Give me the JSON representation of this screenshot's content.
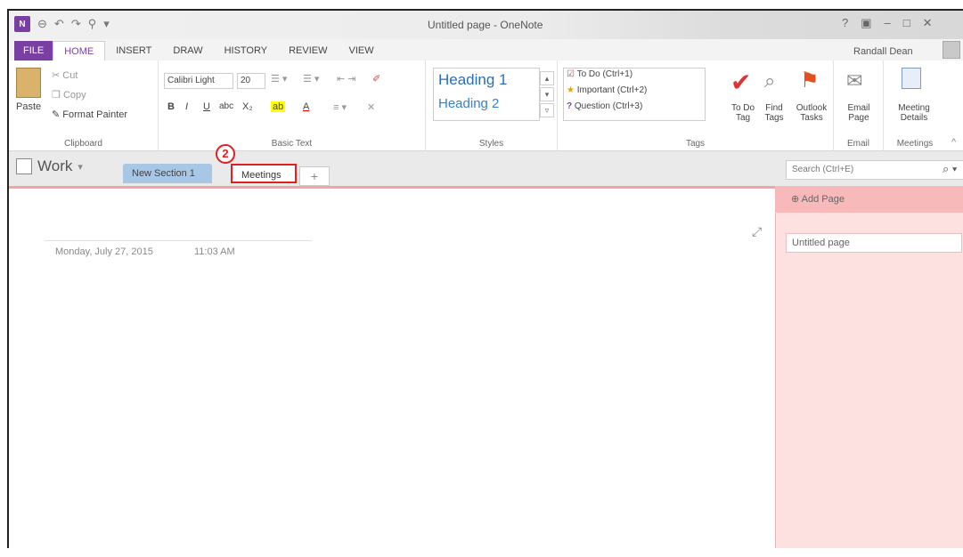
{
  "title_bar": {
    "app_title": "Untitled page - OneNote",
    "logo_text": "N",
    "user_name": "Randall Dean",
    "window_controls": [
      "?",
      "▣",
      "–",
      "□",
      "✕"
    ]
  },
  "ribbon_tabs": [
    "FILE",
    "HOME",
    "INSERT",
    "DRAW",
    "HISTORY",
    "REVIEW",
    "VIEW"
  ],
  "clipboard": {
    "paste": "Paste",
    "cut": "Cut",
    "copy": "Copy",
    "format_painter": "Format Painter",
    "label": "Clipboard"
  },
  "basic_text": {
    "font_name": "Calibri Light",
    "font_size": "20",
    "bold": "B",
    "italic": "I",
    "underline": "U",
    "strike": "abc",
    "subscript": "X₂",
    "highlight": "ab",
    "font_color": "A",
    "label": "Basic Text"
  },
  "styles": {
    "heading1": "Heading 1",
    "heading2": "Heading 2",
    "label": "Styles"
  },
  "tags": {
    "todo": "To Do (Ctrl+1)",
    "important": "Important (Ctrl+2)",
    "question": "Question (Ctrl+3)",
    "todo_tag": "To Do Tag",
    "find_tags": "Find Tags",
    "outlook_tasks": "Outlook Tasks",
    "label": "Tags"
  },
  "email": {
    "email_page": "Email Page",
    "label": "Email"
  },
  "meetings": {
    "meeting_details": "Meeting Details",
    "label": "Meetings"
  },
  "notebook": {
    "name": "Work",
    "sections": [
      "New Section 1",
      "Meetings"
    ],
    "add": "+",
    "step_number": "2",
    "search_placeholder": "Search (Ctrl+E)"
  },
  "page": {
    "date": "Monday, July 27, 2015",
    "time": "11:03 AM"
  },
  "page_list": {
    "add_page": "Add Page",
    "pages": [
      "Untitled page"
    ]
  }
}
